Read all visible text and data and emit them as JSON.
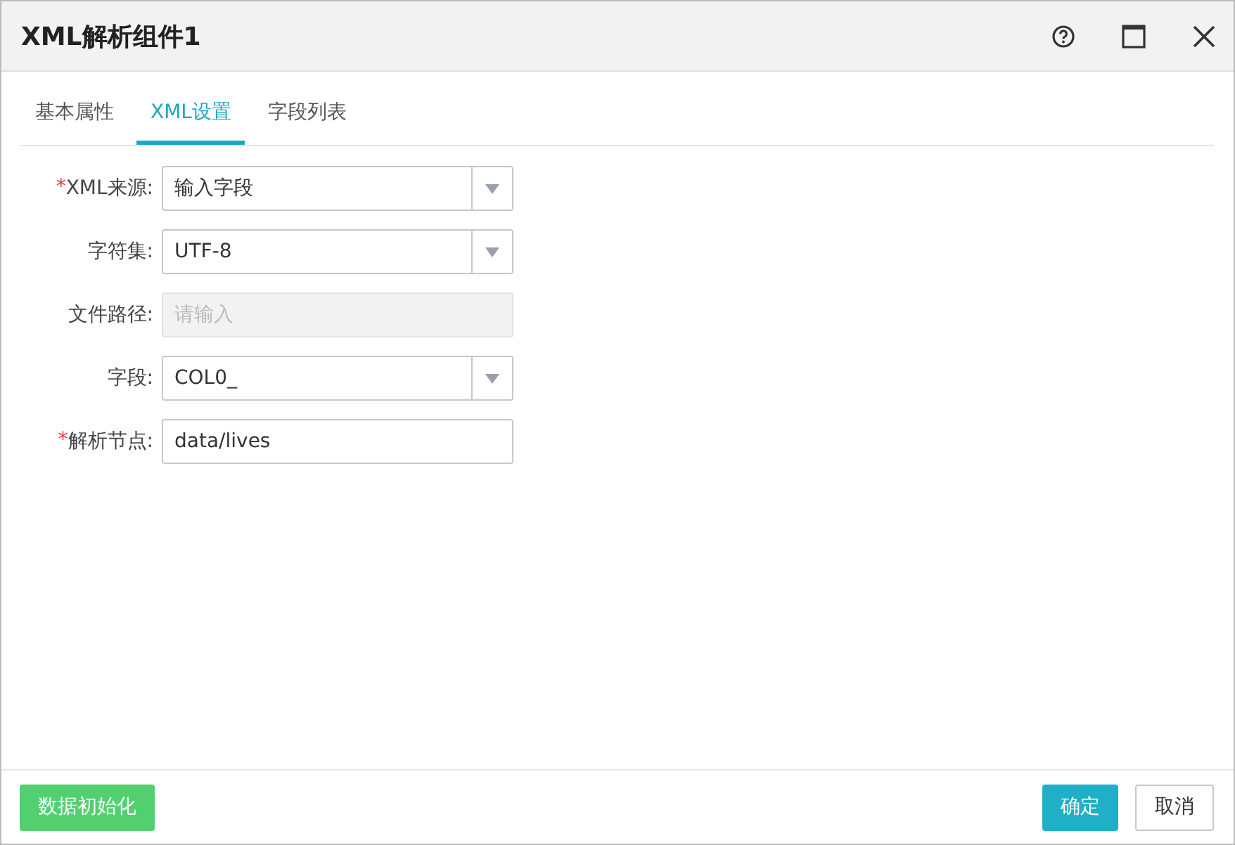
{
  "window": {
    "title": "XML解析组件1"
  },
  "tabs": [
    {
      "label": "基本属性",
      "selected": false
    },
    {
      "label": "XML设置",
      "selected": true
    },
    {
      "label": "字段列表",
      "selected": false
    }
  ],
  "fields": [
    {
      "kind": "select",
      "label": "XML来源:",
      "required_mark": "*",
      "value": "输入字段"
    },
    {
      "kind": "select",
      "label": "字符集:",
      "value": "UTF-8"
    },
    {
      "kind": "input",
      "label": "文件路径:",
      "disabled": true,
      "placeholder": "请输入"
    },
    {
      "kind": "select",
      "label": "字段:",
      "value": "COL0_"
    },
    {
      "kind": "input",
      "label": "解析节点:",
      "required_mark": "*",
      "disabled": false,
      "value": "data/lives"
    }
  ],
  "footer": {
    "init_button": "数据初始化",
    "ok_button": "确定",
    "cancel_button": "取消"
  }
}
